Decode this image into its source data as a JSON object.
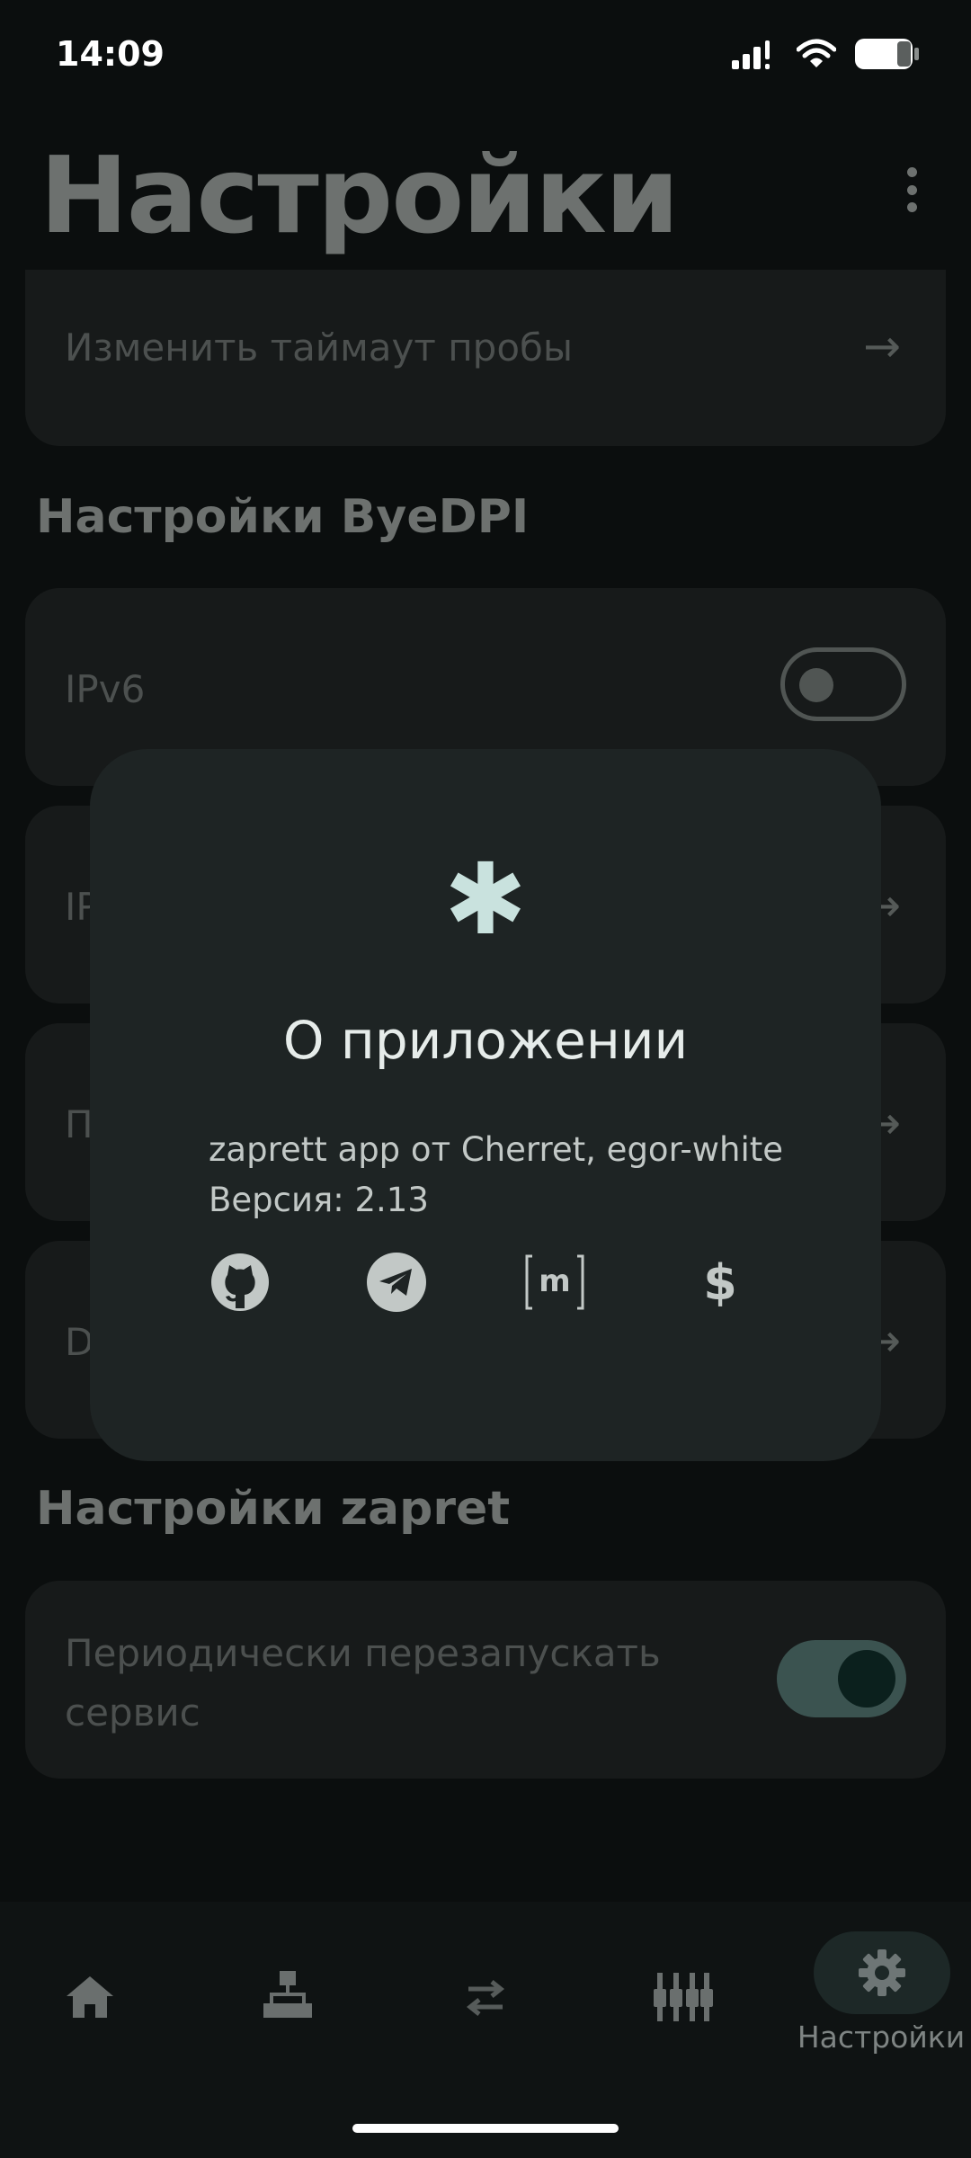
{
  "status_bar": {
    "time": "14:09"
  },
  "header": {
    "title": "Настройки"
  },
  "cards": {
    "probe_timeout": "Изменить таймаут пробы",
    "ipv6_label": "IPv6",
    "ip_partial": "IP",
    "p_partial": "П",
    "d_partial": "D",
    "periodic_restart": "Периодически перезапускать сервис"
  },
  "sections": {
    "byedpi": "Настройки ByeDPI",
    "zapret": "Настройки zapret"
  },
  "toggles": {
    "ipv6": "off",
    "periodic_restart": "on"
  },
  "dialog": {
    "icon": "asterisk-icon",
    "title": "О приложении",
    "line1": "zaprett app от Cherret, egor-white",
    "line2": "Версия: 2.13",
    "links": [
      "github-icon",
      "telegram-icon",
      "matrix-icon",
      "donate-icon"
    ]
  },
  "bottom_nav": {
    "items": [
      "home-icon",
      "hosts-icon",
      "strategies-icon",
      "tuner-icon",
      "settings-icon"
    ],
    "active_label": "Настройки"
  },
  "colors": {
    "background": "#0b0e0e",
    "dialog": "#1e2424",
    "accent": "#c9e2de"
  }
}
